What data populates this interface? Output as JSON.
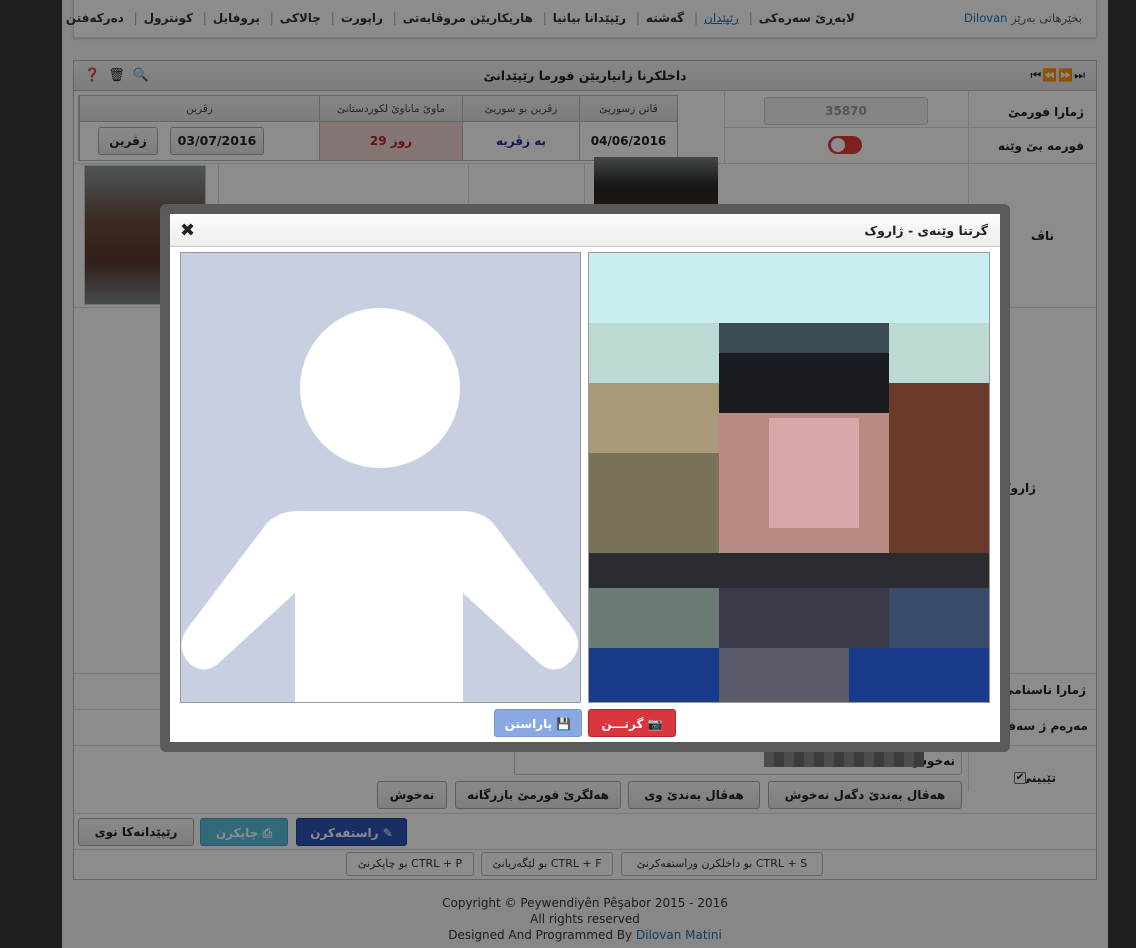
{
  "nav": {
    "welcome_prefix": "بخێرهاتی بەرێز",
    "username": "Dilovan",
    "items": [
      {
        "label": "لاپەڕێ سەرەکی",
        "active": false
      },
      {
        "label": "رێپێدان",
        "active": true
      },
      {
        "label": "گەشتە",
        "active": false
      },
      {
        "label": "رێپێدانا بیانیا",
        "active": false
      },
      {
        "label": "هاریکاریێن مروڤایەتی",
        "active": false
      },
      {
        "label": "راپورت",
        "active": false
      },
      {
        "label": "چالاکی",
        "active": false
      },
      {
        "label": "پروفایل",
        "active": false
      },
      {
        "label": "کونترول",
        "active": false
      },
      {
        "label": "دەرکەفتن",
        "active": false
      }
    ]
  },
  "panel": {
    "title": "داخلکرنا زانیاریێن فورما رێپێدانێ"
  },
  "form": {
    "form_number_label": "ژمارا فورمێ",
    "form_number_value": "35870",
    "no_photo_label": "فورمە بێ وێنە",
    "name_label": "ناڤ",
    "attachments_label": "ژاروک ( 2 )",
    "passport_label": "ژمارا ناسنامێ",
    "residence_label": "مەرەم ژ سەفەرێ",
    "patient_label": "نەخوش",
    "notes_label": "تێبینی"
  },
  "trip": {
    "headers": {
      "departure_date": "ڤاتن زسوریێ",
      "return_to_border": "زڤرین بو سوریێ",
      "duration_in_kurdistan": "ماوێ ماناوێ لکوردستانێ",
      "return": "زڤرین"
    },
    "departure_date": "04/06/2016",
    "return_status": "بە زڤریە",
    "duration": "29 روز",
    "return_date": "03/07/2016",
    "return_button": "زڤرین"
  },
  "actions": {
    "patient_btn": "نەخوش",
    "trade_btn": "هەلگرێ فورمێ بازرگانە",
    "with_patient_btn": "هەڤال بەندێ دگەل نەخوش",
    "companion_btn": "هەڤال بەندێ وی",
    "edit_btn": "راستفەکرن",
    "print_btn": "چاپکرن",
    "new_btn": "رێپێدانەکا نوی"
  },
  "shortcuts": [
    "CTRL + S بو داخلکرن وراستفەکرنێ",
    "CTRL + F بو لێگەریانێ",
    "CTRL + P بو چاپکرنێ"
  ],
  "footer": {
    "copyright": "Copyright © Peywendiyên Pêşabor 2015 - 2016",
    "rights": "All rights reserved",
    "designed_prefix": "Designed And Programmed By",
    "designer": "Dilovan Matini"
  },
  "modal": {
    "title": "گرتنا وێنەی - ژاروک",
    "capture_btn": "گرتـــن",
    "save_btn": "پاراستن"
  },
  "colors": {
    "accent_blue": "#1e6fb6",
    "edit_btn": "#2a56b8",
    "print_btn": "#5bc0de",
    "capture_btn": "#d9363e",
    "save_btn": "#8aa8e4",
    "toggle_off": "#e23b3b"
  }
}
